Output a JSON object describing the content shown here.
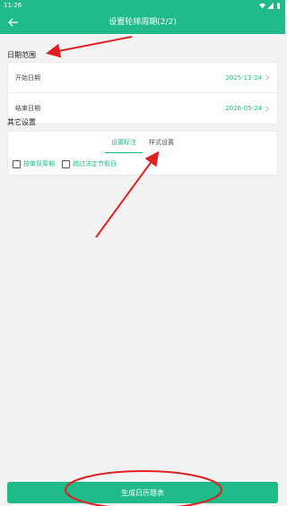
{
  "status_bar": {
    "time": "11:26"
  },
  "app_bar": {
    "title": "设置轮排周期(2/2)",
    "back_icon": "arrow-left-icon"
  },
  "date_range": {
    "label": "日期范围",
    "rows": [
      {
        "label": "开始日期",
        "value": "2025-11-24"
      },
      {
        "label": "结束日期",
        "value": "2026-05-24"
      }
    ]
  },
  "other_settings": {
    "label": "其它设置",
    "tabs": [
      {
        "label": "设置标注",
        "active": true
      },
      {
        "label": "样式设置",
        "active": false
      }
    ],
    "options": [
      {
        "label": "按单双周期"
      },
      {
        "label": "跳过法定节假日"
      }
    ]
  },
  "generate_button": {
    "label": "生成日历题表"
  },
  "annotation_color": "#e02020",
  "accent_color": "#1fb98a"
}
